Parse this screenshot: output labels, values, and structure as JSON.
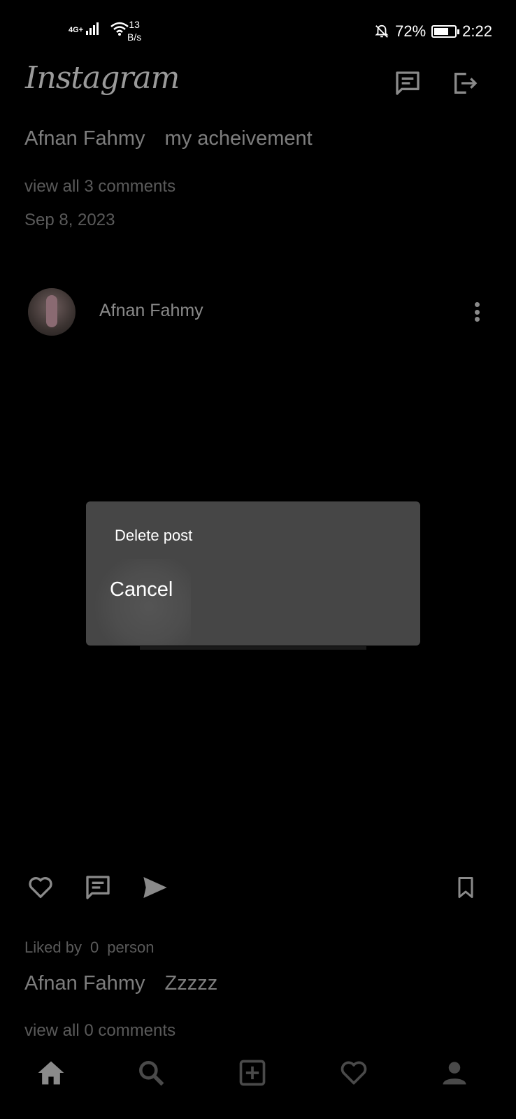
{
  "status_bar": {
    "network": "4G+",
    "speed_value": "13",
    "speed_unit": "B/s",
    "battery": "72%",
    "battery_level": 0.72,
    "time": "2:22"
  },
  "header": {
    "logo": "Instagram",
    "messages_icon": "messages-icon",
    "logout_icon": "logout-icon"
  },
  "previous_post": {
    "author": "Afnan Fahmy",
    "caption": "my acheivement",
    "comments_link": "view all 3 comments",
    "date": "Sep 8, 2023"
  },
  "post": {
    "author": "Afnan Fahmy",
    "liked_by_prefix": "Liked by",
    "liked_count": "0",
    "liked_by_suffix": "person",
    "caption_author": "Afnan Fahmy",
    "caption": "Zzzzz",
    "comments_link": "view all 0 comments"
  },
  "dialog": {
    "delete_label": "Delete post",
    "cancel_label": "Cancel"
  },
  "colors": {
    "background": "#000000",
    "dialog": "#464646",
    "dim_text": "#8a8a8a"
  },
  "bottom_nav": [
    "home-icon",
    "search-icon",
    "add-post-icon",
    "heart-icon",
    "profile-icon"
  ]
}
